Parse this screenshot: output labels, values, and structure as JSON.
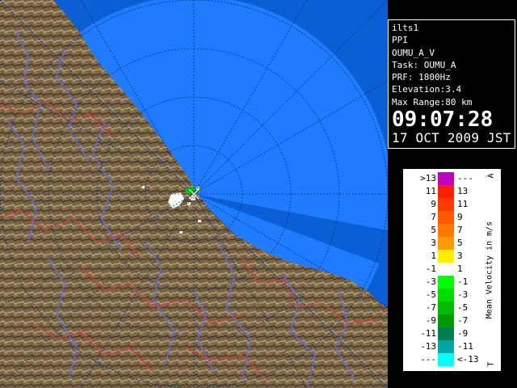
{
  "info": {
    "station": "ilts1",
    "scan_type": "PPI",
    "product": "OUMU_A_V",
    "task": "Task: OUMU_A",
    "prf": "PRF: 1800Hz",
    "elevation": "Elevation:3.4",
    "max_range": "Max Range:80 km",
    "time": "09:07:28",
    "date": "17 OCT 2009 JST"
  },
  "legend": {
    "title": "Mean Velocity in m/s",
    "corner_top": "A",
    "corner_bottom": "T",
    "rows": [
      {
        "lo": ">13",
        "hi": "---",
        "color": "#c000c0"
      },
      {
        "lo": "11",
        "hi": "13",
        "color": "#ff1e00"
      },
      {
        "lo": "9",
        "hi": "11",
        "color": "#ff3a00"
      },
      {
        "lo": "7",
        "hi": "9",
        "color": "#ff5a00"
      },
      {
        "lo": "5",
        "hi": "7",
        "color": "#ff7a00"
      },
      {
        "lo": "3",
        "hi": "5",
        "color": "#ff9c00"
      },
      {
        "lo": "1",
        "hi": "3",
        "color": "#ffee00"
      },
      {
        "lo": "-1",
        "hi": "1",
        "color": "#ffffff"
      },
      {
        "lo": "-3",
        "hi": "-1",
        "color": "#00ff00"
      },
      {
        "lo": "-5",
        "hi": "-3",
        "color": "#00dd00"
      },
      {
        "lo": "-7",
        "hi": "-5",
        "color": "#00bb00"
      },
      {
        "lo": "-9",
        "hi": "-7",
        "color": "#009900"
      },
      {
        "lo": "-11",
        "hi": "-9",
        "color": "#007f55"
      },
      {
        "lo": "-13",
        "hi": "-11",
        "color": "#00a8a8"
      },
      {
        "lo": "---",
        "hi": "<-13",
        "color": "#00ffff"
      }
    ]
  },
  "colors": {
    "sea": "#0a5fd6",
    "radar_coverage": "#1e78ff",
    "terrain": "#7d6a4c",
    "rivers": "#5a6ee0",
    "boundaries": "#d84040"
  }
}
